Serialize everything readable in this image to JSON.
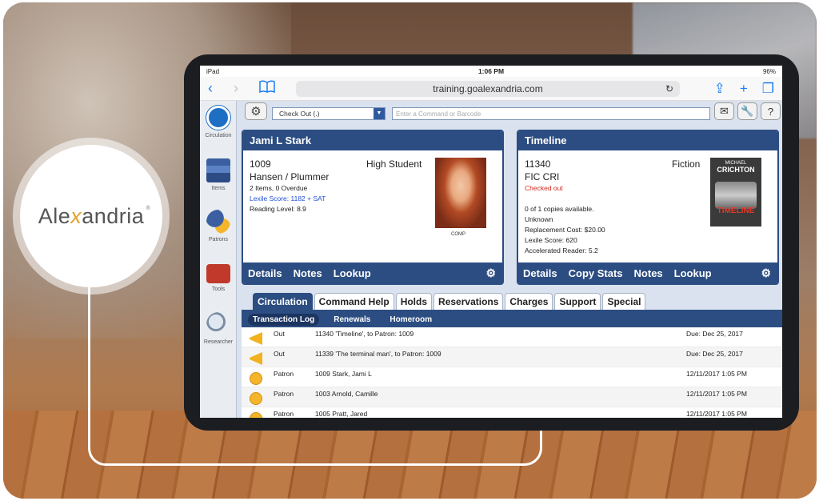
{
  "logo": {
    "pre": "Ale",
    "x": "x",
    "post": "andria",
    "reg": "®"
  },
  "status": {
    "device": "iPad",
    "time": "1:06 PM",
    "battery": "96%"
  },
  "safari": {
    "url": "training.goalexandria.com",
    "back": "‹",
    "forward": "›"
  },
  "sidebar": [
    {
      "label": "Circulation",
      "icon": "circulation-icon"
    },
    {
      "label": "Items",
      "icon": "books-icon"
    },
    {
      "label": "Patrons",
      "icon": "patrons-icon"
    },
    {
      "label": "Tools",
      "icon": "toolbox-icon"
    },
    {
      "label": "Researcher",
      "icon": "magnifier-icon"
    }
  ],
  "toolbar": {
    "mode": "Check Out (.)",
    "command_placeholder": "Enter a Command or Barcode"
  },
  "patron": {
    "name": "Jami L Stark",
    "id": "1009",
    "type": "High Student",
    "teacher": "Hansen / Plummer",
    "items": "2 Items, 0 Overdue",
    "lexile": "Lexile Score: 1182 + SAT",
    "reading": "Reading Level: 8.9",
    "photo_caption": "COMP",
    "footer": [
      "Details",
      "Notes",
      "Lookup"
    ]
  },
  "item": {
    "title": "Timeline",
    "id": "11340",
    "genre": "Fiction",
    "call": "FIC CRI",
    "status": "Checked out",
    "copies": "0 of 1 copies available.",
    "unknown": "Unknown",
    "cost": "Replacement Cost: $20.00",
    "lexile": "Lexile Score: 620",
    "ar": "Accelerated Reader: 5.2",
    "cover_author_small": "MICHAEL",
    "cover_author": "CRICHTON",
    "cover_title": "TIMELINE",
    "footer": [
      "Details",
      "Copy Stats",
      "Notes",
      "Lookup"
    ]
  },
  "tabs": [
    "Circulation",
    "Command Help",
    "Holds",
    "Reservations",
    "Charges",
    "Support",
    "Special"
  ],
  "subtabs": [
    "Transaction Log",
    "Renewals",
    "Homeroom"
  ],
  "log": [
    {
      "type": "Out",
      "desc": "11340 'Timeline', to Patron: 1009",
      "when": "Due: Dec 25, 2017",
      "icon": "arrow"
    },
    {
      "type": "Out",
      "desc": "11339 'The terminal man', to Patron: 1009",
      "when": "Due: Dec 25, 2017",
      "icon": "arrow"
    },
    {
      "type": "Patron",
      "desc": "1009 Stark, Jami L",
      "when": "12/11/2017 1:05 PM",
      "icon": "smile"
    },
    {
      "type": "Patron",
      "desc": "1003 Arnold, Camille",
      "when": "12/11/2017 1:05 PM",
      "icon": "smile"
    },
    {
      "type": "Patron",
      "desc": "1005 Pratt, Jared",
      "when": "12/11/2017 1:05 PM",
      "icon": "smile"
    }
  ]
}
